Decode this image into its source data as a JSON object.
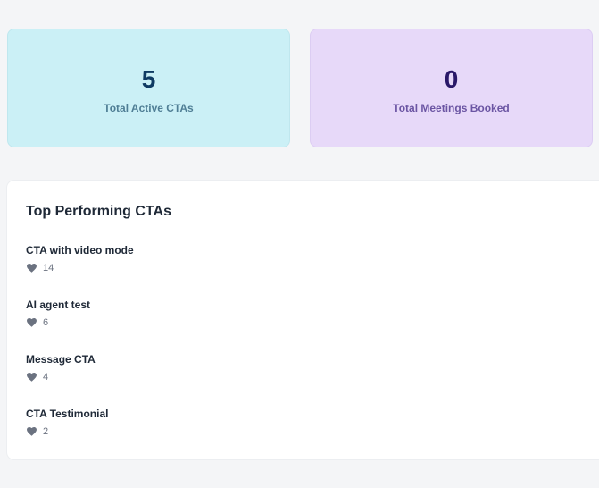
{
  "stats": {
    "active_ctas": {
      "value": "5",
      "label": "Total Active CTAs"
    },
    "meetings_booked": {
      "value": "0",
      "label": "Total Meetings Booked"
    }
  },
  "top_ctas": {
    "title": "Top Performing CTAs",
    "items": [
      {
        "name": "CTA with video mode",
        "likes": "14"
      },
      {
        "name": "AI agent test",
        "likes": "6"
      },
      {
        "name": "Message CTA",
        "likes": "4"
      },
      {
        "name": "CTA Testimonial",
        "likes": "2"
      }
    ]
  },
  "icons": {
    "like": "heart-icon"
  },
  "colors": {
    "cta_card_bg": "#cbf0f6",
    "meetings_card_bg": "#e7d9f9",
    "heart": "#6b7280"
  }
}
